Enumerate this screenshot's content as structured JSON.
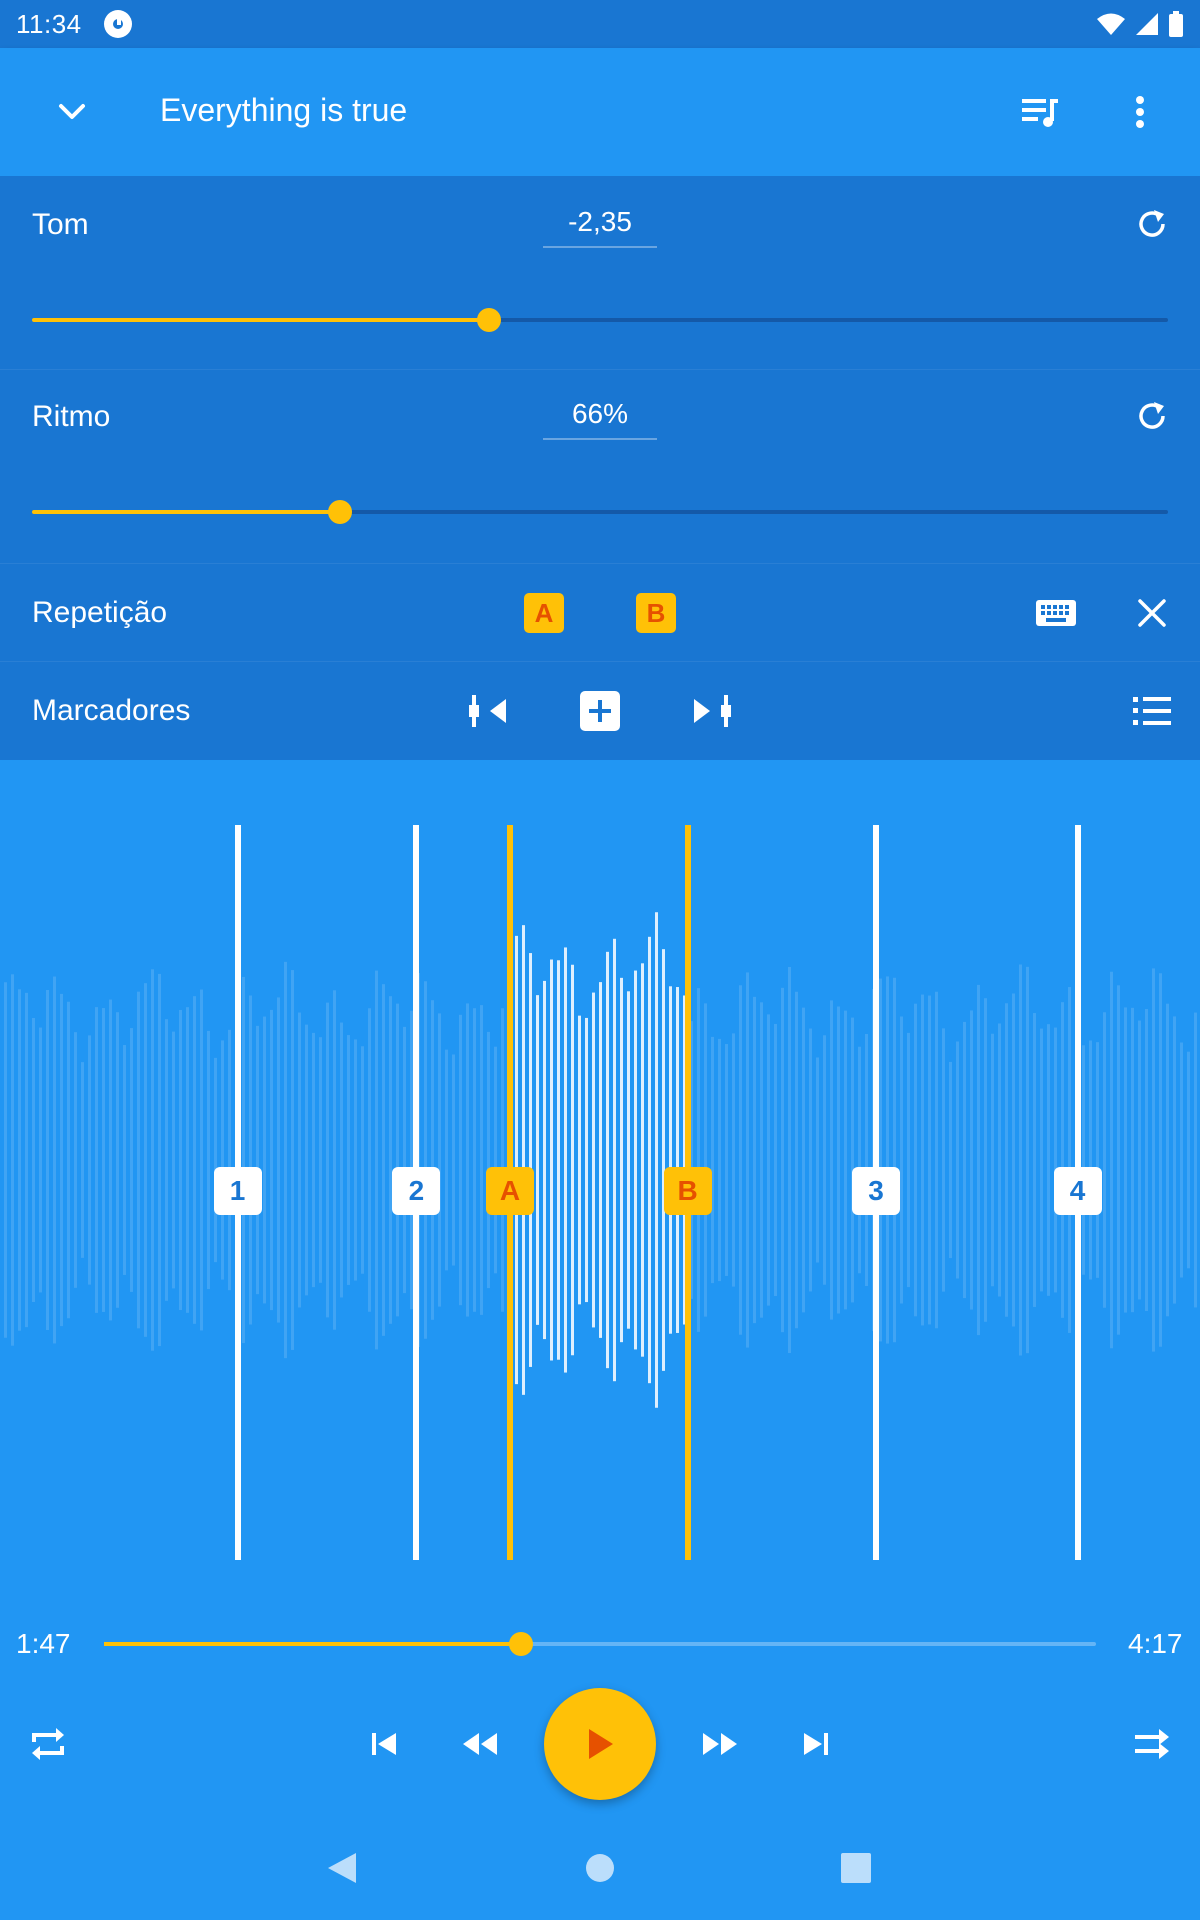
{
  "status_bar": {
    "time": "11:34"
  },
  "app_bar": {
    "title": "Everything is true",
    "back_icon": "chevron-down-icon",
    "queue_icon": "queue-music-icon",
    "more_icon": "more-vert-icon"
  },
  "pitch": {
    "label": "Tom",
    "value": "-2,35",
    "slider_fraction": 0.402
  },
  "tempo": {
    "label": "Ritmo",
    "value": "66%",
    "slider_fraction": 0.271
  },
  "loop": {
    "label": "Repetição",
    "a_label": "A",
    "b_label": "B",
    "keyboard_icon": "keyboard-icon",
    "close_icon": "close-icon"
  },
  "markers_row": {
    "label": "Marcadores",
    "prev_icon": "previous-marker-icon",
    "add_icon": "add-marker-icon",
    "next_icon": "next-marker-icon",
    "list_icon": "marker-list-icon"
  },
  "waveform_markers": [
    {
      "label": "1",
      "kind": "marker",
      "position_fraction": 0.198
    },
    {
      "label": "2",
      "kind": "marker",
      "position_fraction": 0.347
    },
    {
      "label": "A",
      "kind": "loop",
      "position_fraction": 0.425
    },
    {
      "label": "B",
      "kind": "loop",
      "position_fraction": 0.573
    },
    {
      "label": "3",
      "kind": "marker",
      "position_fraction": 0.73
    },
    {
      "label": "4",
      "kind": "marker",
      "position_fraction": 0.898
    }
  ],
  "playback": {
    "current_time": "1:47",
    "total_time": "4:17",
    "progress_fraction": 0.42
  },
  "colors": {
    "primary": "#2196F3",
    "primary_dark": "#1976D2",
    "accent": "#FFC107",
    "accent_text": "#E65100"
  }
}
